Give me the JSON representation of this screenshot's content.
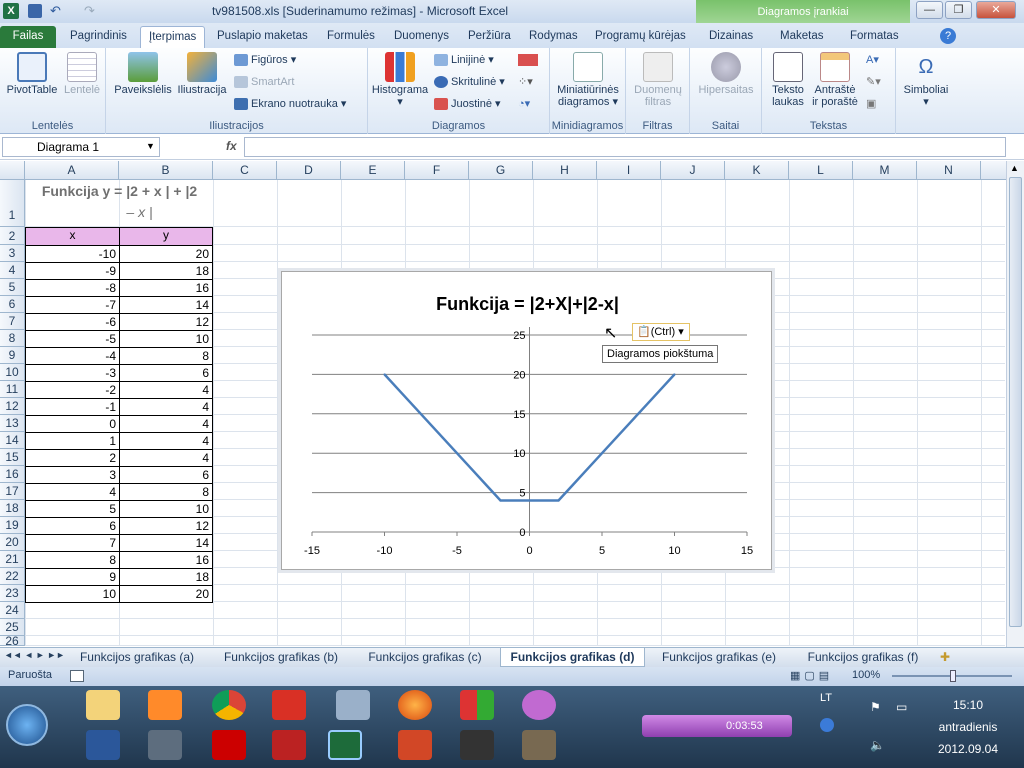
{
  "window": {
    "title": "tv981508.xls  [Suderinamumo režimas]  -  Microsoft Excel",
    "context_tab_group": "Diagramos įrankiai"
  },
  "tabs": [
    "Failas",
    "Pagrindinis",
    "Įterpimas",
    "Puslapio maketas",
    "Formulės",
    "Duomenys",
    "Peržiūra",
    "Rodymas",
    "Programų kūrėjas",
    "Dizainas",
    "Maketas",
    "Formatas"
  ],
  "ribbon": {
    "groups": [
      "Lentelės",
      "Iliustracijos",
      "Diagramos",
      "Minidiagramos",
      "Filtras",
      "Saitai",
      "Tekstas"
    ],
    "buttons": {
      "pivottable": "PivotTable",
      "table": "Lentelė",
      "picture": "Paveikslėlis",
      "clipart": "Iliustracija",
      "shapes": "Figūros",
      "smartart": "SmartArt",
      "screenshot": "Ekrano nuotrauka",
      "histogram": "Histograma",
      "line": "Linijinė",
      "pie": "Skritulinė",
      "bar": "Juostinė",
      "sparklines": "Miniatiūrinės diagramos",
      "slicer": "Duomenų filtras",
      "hyperlink": "Hipersaitas",
      "textbox": "Teksto laukas",
      "header": "Antraštė ir poraštė",
      "symbols": "Simboliai"
    }
  },
  "formula_bar": {
    "name_box": "Diagrama 1",
    "fx": "fx",
    "value": ""
  },
  "columns": [
    "A",
    "B",
    "C",
    "D",
    "E",
    "F",
    "G",
    "H",
    "I",
    "J",
    "K",
    "L",
    "M",
    "N"
  ],
  "rows": [
    "1",
    "2",
    "3",
    "4",
    "5",
    "6",
    "7",
    "8",
    "9",
    "10",
    "11",
    "12",
    "13",
    "14",
    "15",
    "16",
    "17",
    "18",
    "19",
    "20",
    "21",
    "22",
    "23",
    "24",
    "25",
    "26"
  ],
  "sheet": {
    "title_line1": "Funkcija  y  = |2 + x | + |2",
    "title_line2": "– x |",
    "header_x": "x",
    "header_y": "y",
    "x_values": [
      "-10",
      "-9",
      "-8",
      "-7",
      "-6",
      "-5",
      "-4",
      "-3",
      "-2",
      "-1",
      "0",
      "1",
      "2",
      "3",
      "4",
      "5",
      "6",
      "7",
      "8",
      "9",
      "10"
    ],
    "y_values": [
      "20",
      "18",
      "16",
      "14",
      "12",
      "10",
      "8",
      "6",
      "4",
      "4",
      "4",
      "4",
      "4",
      "6",
      "8",
      "10",
      "12",
      "14",
      "16",
      "18",
      "20"
    ]
  },
  "chart_data": {
    "type": "scatter",
    "title": "Funkcija = |2+X|+|2-x|",
    "x": [
      -10,
      -9,
      -8,
      -7,
      -6,
      -5,
      -4,
      -3,
      -2,
      -1,
      0,
      1,
      2,
      3,
      4,
      5,
      6,
      7,
      8,
      9,
      10
    ],
    "y": [
      20,
      18,
      16,
      14,
      12,
      10,
      8,
      6,
      4,
      4,
      4,
      4,
      4,
      6,
      8,
      10,
      12,
      14,
      16,
      18,
      20
    ],
    "xlim": [
      -15,
      15
    ],
    "ylim": [
      0,
      25
    ],
    "x_ticks": [
      "-15",
      "-10",
      "-5",
      "0",
      "5",
      "10",
      "15"
    ],
    "y_ticks": [
      "0",
      "5",
      "10",
      "15",
      "20",
      "25"
    ],
    "grid": true,
    "line_color": "#4a7ebb"
  },
  "paste_options": {
    "label": "(Ctrl)",
    "tooltip": "Diagramos piokštuma"
  },
  "sheet_tabs": [
    "Funkcijos grafikas (a)",
    "Funkcijos grafikas (b)",
    "Funkcijos grafikas (c)",
    "Funkcijos grafikas (d)",
    "Funkcijos grafikas (e)",
    "Funkcijos grafikas (f)"
  ],
  "active_sheet_index": 3,
  "status": {
    "ready": "Paruošta",
    "zoom": "100%"
  },
  "taskbar": {
    "lang": "LT",
    "time": "15:10",
    "day": "antradienis",
    "date": "2012.09.04",
    "recorder_time": "0:03:53"
  }
}
